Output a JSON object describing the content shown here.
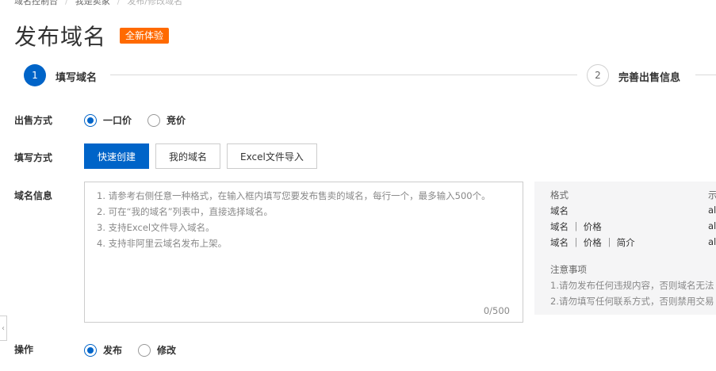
{
  "breadcrumb": [
    {
      "label": "域名控制台"
    },
    {
      "label": "我是卖家"
    },
    {
      "label": "发布/修改域名"
    }
  ],
  "page": {
    "title": "发布域名",
    "badge": "全新体验"
  },
  "steps": [
    {
      "number": "1",
      "label": "填写域名"
    },
    {
      "number": "2",
      "label": "完善出售信息"
    }
  ],
  "form": {
    "sale_method": {
      "label": "出售方式",
      "options": [
        {
          "label": "一口价",
          "checked": true
        },
        {
          "label": "竞价",
          "checked": false
        }
      ]
    },
    "fill_method": {
      "label": "填写方式",
      "buttons": [
        {
          "label": "快速创建",
          "active": true
        },
        {
          "label": "我的域名",
          "active": false
        },
        {
          "label": "Excel文件导入",
          "active": false
        }
      ]
    },
    "domain_info": {
      "label": "域名信息",
      "placeholder_lines": [
        "1. 请参考右侧任意一种格式，在输入框内填写您要发布售卖的域名，每行一个，最多输入500个。",
        "2. 可在“我的域名”列表中，直接选择域名。",
        "3. 支持Excel文件导入域名。",
        "4. 支持非阿里云域名发布上架。"
      ],
      "char_count": "0/500"
    },
    "operation": {
      "label": "操作",
      "options": [
        {
          "label": "发布",
          "checked": true
        },
        {
          "label": "修改",
          "checked": false
        }
      ]
    }
  },
  "help_panel": {
    "format_header": "格式",
    "example_header": "示",
    "rows": [
      {
        "format": "域名",
        "example": "al"
      },
      {
        "format": "域名 ｜ 价格",
        "example": "al"
      },
      {
        "format": "域名 ｜ 价格 ｜ 简介",
        "example": "al"
      }
    ],
    "notes_title": "注意事项",
    "notes": [
      "1.请勿发布任何违规内容，否则域名无法",
      "2.请勿填写任何联系方式，否则禁用交易"
    ]
  },
  "colors": {
    "primary": "#0064c8",
    "badge": "#ff6a00"
  }
}
